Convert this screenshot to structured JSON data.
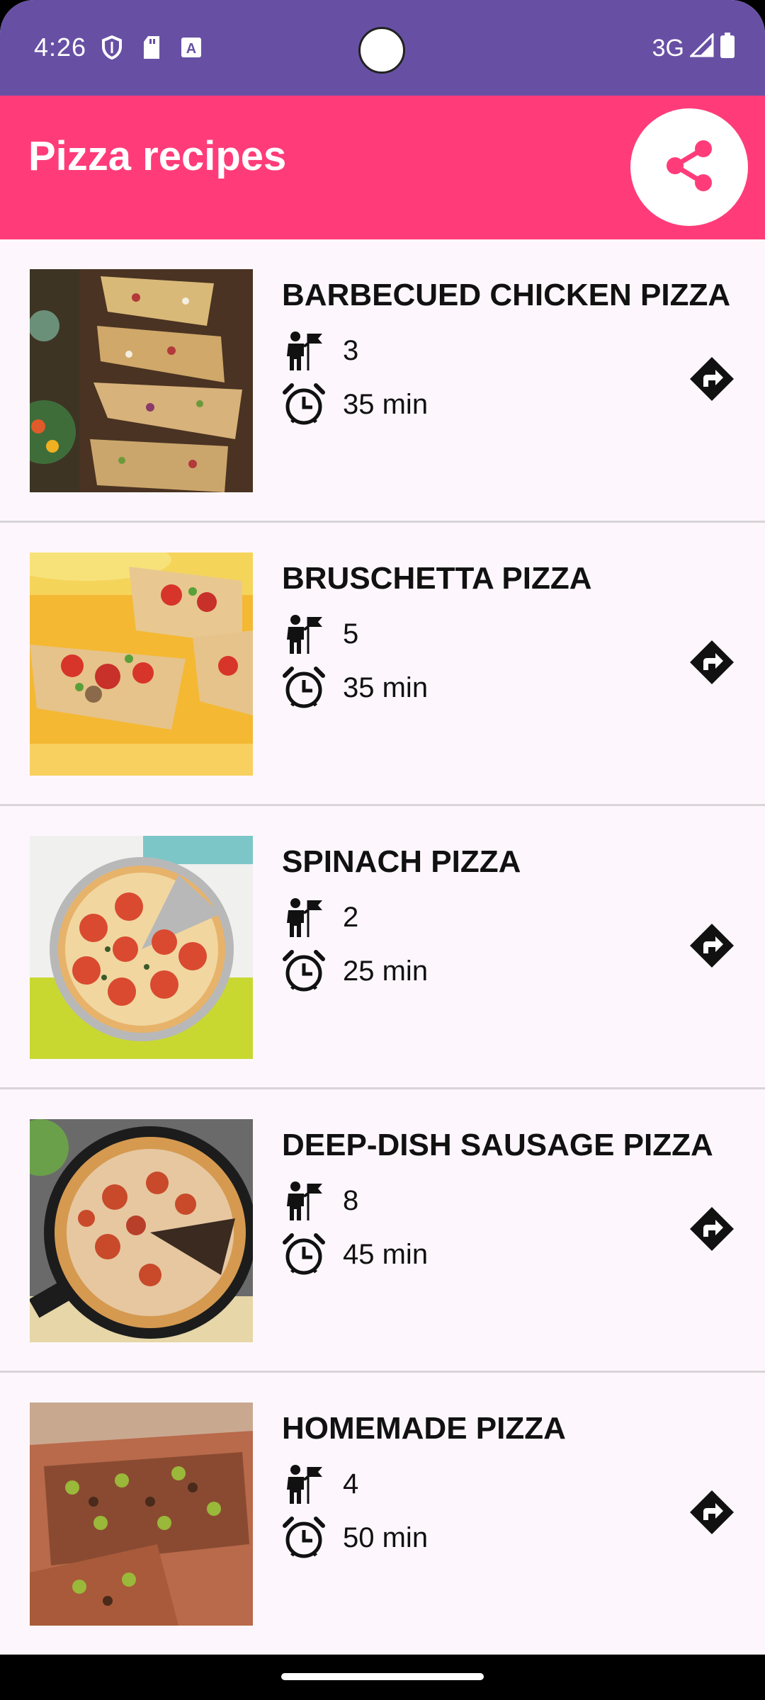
{
  "status_bar": {
    "time": "4:26",
    "network": "3G",
    "icons": [
      "shield-icon",
      "sd-card-icon",
      "font-download-icon",
      "signal-icon",
      "battery-icon"
    ]
  },
  "app_bar": {
    "title": "Pizza recipes",
    "share_icon": "share-icon",
    "background": "#ff3c79",
    "status_background": "#6750a4"
  },
  "recipes": [
    {
      "title": "BARBECUED CHICKEN PIZZA",
      "servings": "3",
      "time": "35 min"
    },
    {
      "title": "BRUSCHETTA PIZZA",
      "servings": "5",
      "time": "35 min"
    },
    {
      "title": "SPINACH PIZZA",
      "servings": "2",
      "time": "25 min"
    },
    {
      "title": "DEEP-DISH SAUSAGE PIZZA",
      "servings": "8",
      "time": "45 min"
    },
    {
      "title": "HOMEMADE PIZZA",
      "servings": "4",
      "time": "50 min"
    }
  ]
}
